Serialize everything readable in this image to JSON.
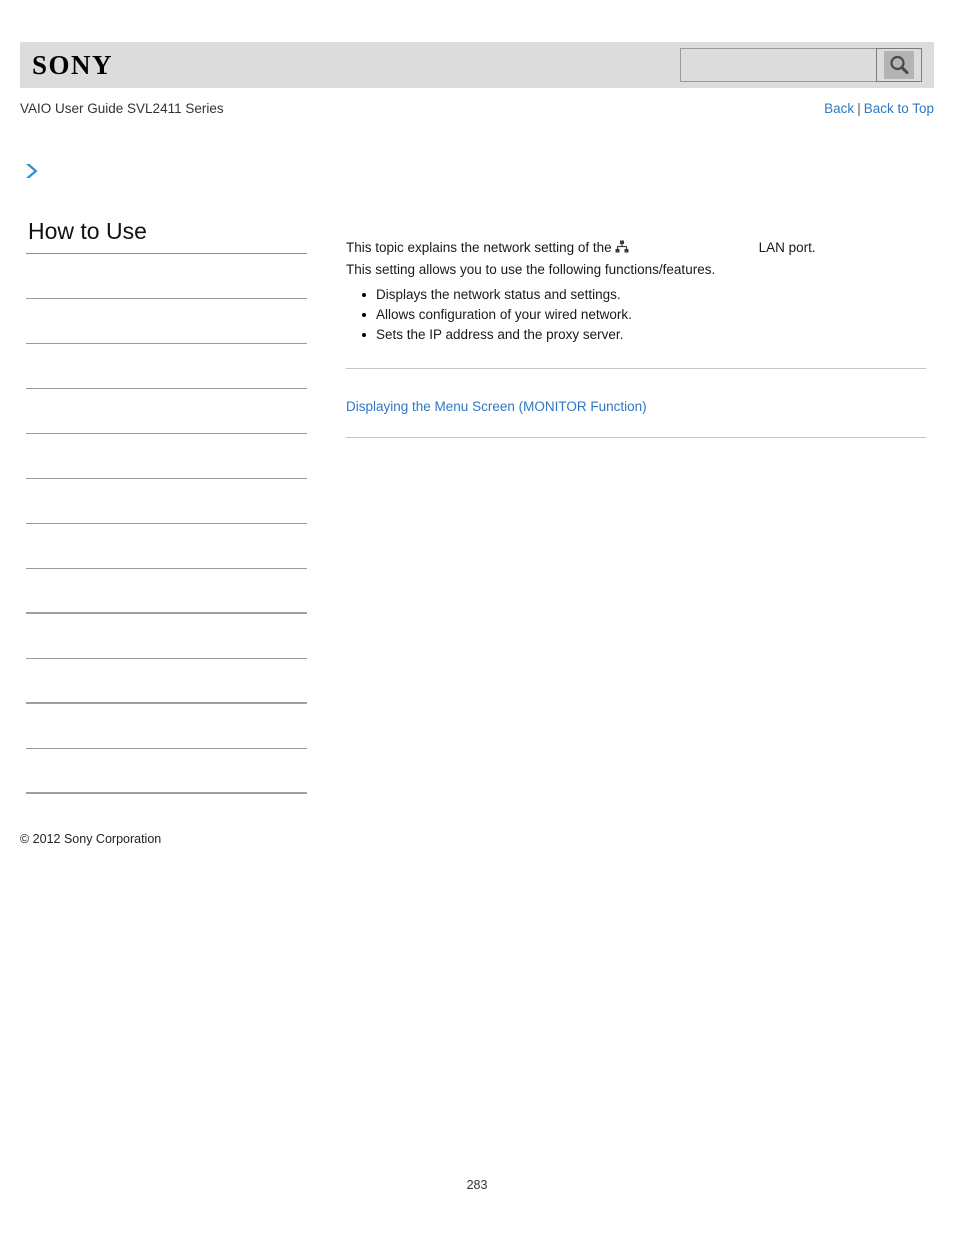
{
  "header": {
    "logo": "SONY",
    "search": {
      "value": "",
      "placeholder": "",
      "icon": "search-icon"
    }
  },
  "subheader": {
    "title": "VAIO User Guide SVL2411 Series",
    "nav": {
      "back": "Back",
      "separator": "|",
      "back_to_top": "Back to Top"
    }
  },
  "breadcrumb": {
    "icon": "chevron-right-icon"
  },
  "sidebar": {
    "title": "How to Use",
    "items": [
      {
        "label": ""
      },
      {
        "label": ""
      },
      {
        "label": ""
      },
      {
        "label": ""
      },
      {
        "label": ""
      },
      {
        "label": ""
      },
      {
        "label": ""
      },
      {
        "label": ""
      },
      {
        "label": ""
      },
      {
        "label": ""
      },
      {
        "label": ""
      },
      {
        "label": ""
      },
      {
        "label": ""
      }
    ]
  },
  "content": {
    "intro_before_icon": "This topic explains the network setting of the",
    "inline_icon": "lan-network-icon",
    "intro_after_icon": "LAN port.",
    "lead": "This setting allows you to use the following functions/features.",
    "features": [
      "Displays the network status and settings.",
      "Allows configuration of your wired network.",
      "Sets the IP address and the proxy server."
    ],
    "related_link": "Displaying the Menu Screen (MONITOR Function)"
  },
  "footer": {
    "copyright": "© 2012 Sony Corporation",
    "page_number": "283"
  },
  "colors": {
    "link": "#2f78c4",
    "header_bg": "#dcdcdc",
    "rule": "#9a9a9a"
  }
}
